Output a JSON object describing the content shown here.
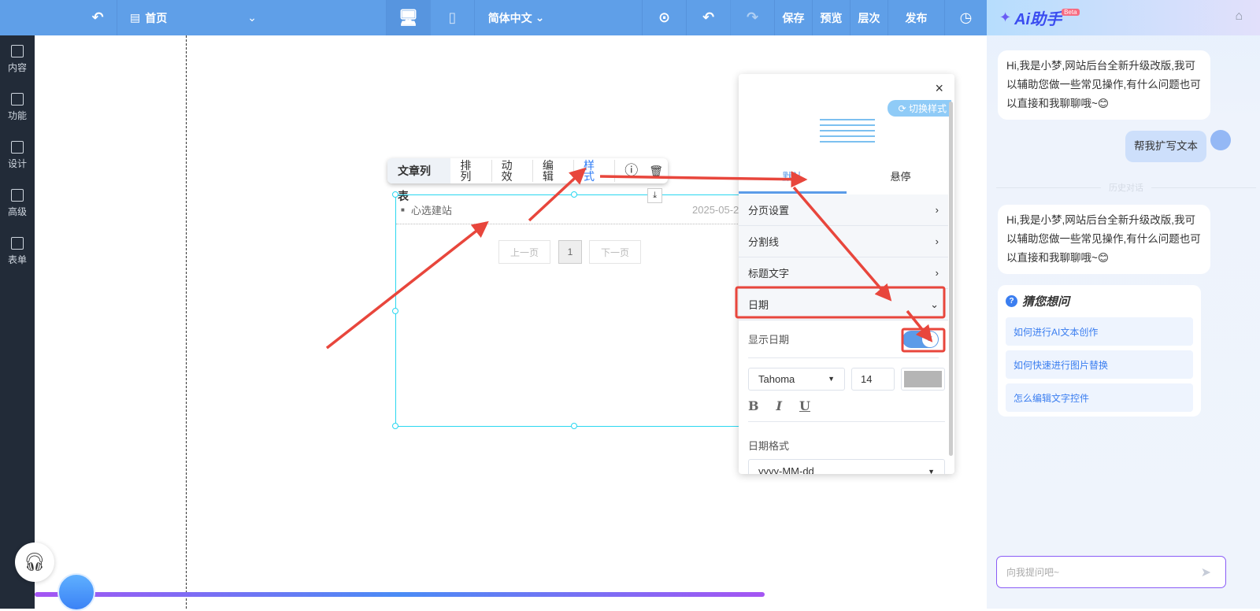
{
  "topbar": {
    "page": "首页",
    "language": "简体中文",
    "save": "保存",
    "preview": "预览",
    "layers": "层次",
    "publish": "发布"
  },
  "sidebar": {
    "items": [
      {
        "label": "内容"
      },
      {
        "label": "功能"
      },
      {
        "label": "设计"
      },
      {
        "label": "高级"
      },
      {
        "label": "表单"
      }
    ]
  },
  "toolbar": {
    "title": "文章列表",
    "items": [
      "排列",
      "动效",
      "编辑",
      "样式"
    ]
  },
  "widget": {
    "article_title": "心选建站",
    "article_date": "2025-05-2",
    "prev": "上一页",
    "page": "1",
    "next": "下一页"
  },
  "panel": {
    "switch_style": "切换样式",
    "tabs": [
      "默认",
      "悬停"
    ],
    "sections": [
      "分页设置",
      "分割线",
      "标题文字",
      "日期"
    ],
    "show_date_label": "显示日期",
    "show_date": true,
    "font": "Tahoma",
    "font_size": "14",
    "color": "#b5b5b5",
    "bold": "B",
    "italic": "I",
    "underline": "U",
    "date_format_label": "日期格式",
    "date_format": "yyyy-MM-dd"
  },
  "ai": {
    "title": "Ai助手",
    "beta": "Beta",
    "greeting": "Hi,我是小梦,网站后台全新升级改版,我可以辅助您做一些常见操作,有什么问题也可以直接和我聊聊哦~😊",
    "user_msg": "帮我扩写文本",
    "history": "历史对话",
    "suggest_title": "猜您想问",
    "suggestions": [
      "如何进行AI文本创作",
      "如何快速进行图片替换",
      "怎么编辑文字控件"
    ],
    "input_placeholder": "向我提问吧~"
  }
}
